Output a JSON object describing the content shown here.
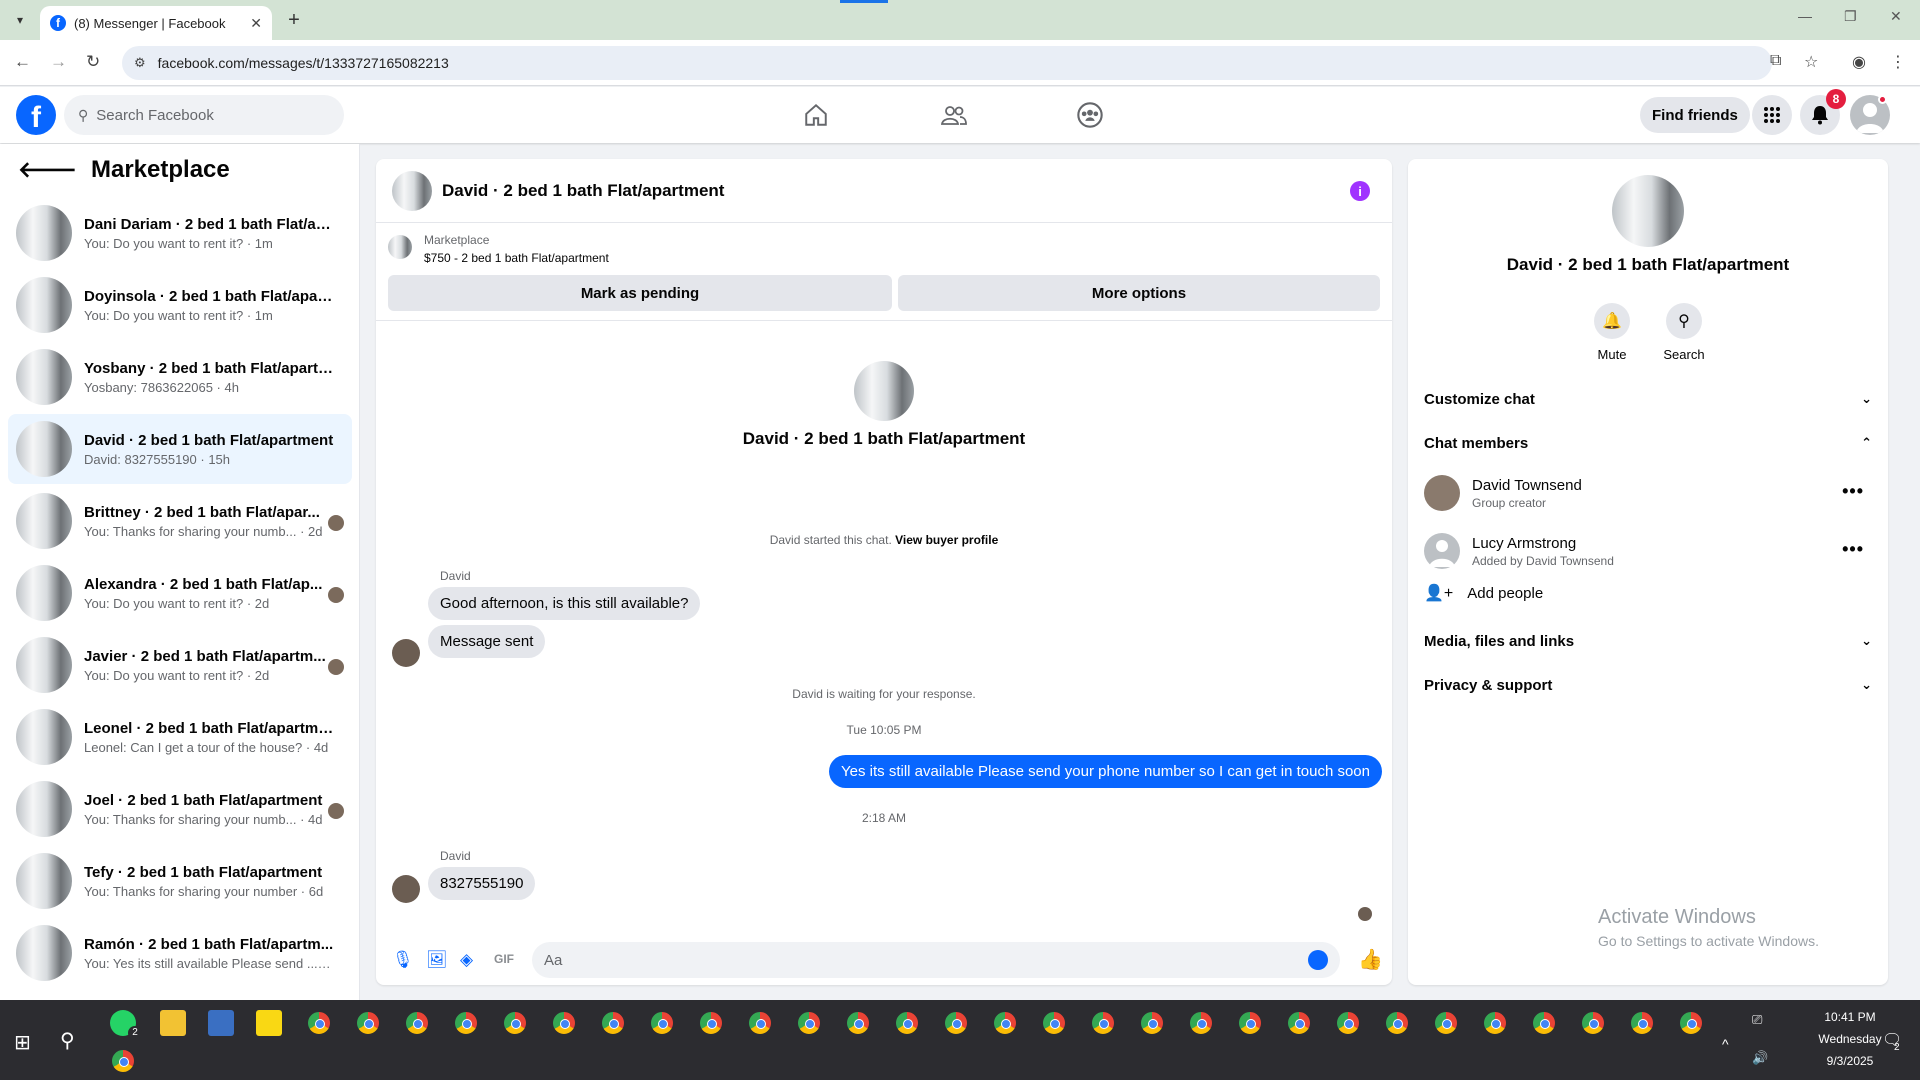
{
  "browser": {
    "tab_title": "(8) Messenger | Facebook",
    "url": "facebook.com/messages/t/1333727165082213"
  },
  "header": {
    "search_placeholder": "Search Facebook",
    "find_friends": "Find friends",
    "notification_count": "8",
    "brand_color": "#0866ff"
  },
  "sidebar": {
    "title": "Marketplace",
    "conversations": [
      {
        "name": "Dani Dariam · 2 bed 1 bath Flat/ap...",
        "preview": "You: Do you want to rent it? · 1m",
        "seen": false
      },
      {
        "name": "Doyinsola · 2 bed 1 bath Flat/apart...",
        "preview": "You: Do you want to rent it? · 1m",
        "seen": false
      },
      {
        "name": "Yosbany · 2 bed 1 bath Flat/apartm...",
        "preview": "Yosbany: 7863622065 · 4h",
        "seen": false
      },
      {
        "name": "David · 2 bed 1 bath Flat/apartment",
        "preview": "David: 8327555190 · 15h",
        "seen": false
      },
      {
        "name": "Brittney · 2 bed 1 bath Flat/apar...",
        "preview": "You: Thanks for sharing your numb... · 2d",
        "seen": true
      },
      {
        "name": "Alexandra · 2 bed 1 bath Flat/ap...",
        "preview": "You: Do you want to rent it? · 2d",
        "seen": true
      },
      {
        "name": "Javier · 2 bed 1 bath Flat/apartm...",
        "preview": "You: Do you want to rent it? · 2d",
        "seen": true
      },
      {
        "name": "Leonel · 2 bed 1 bath Flat/apartment",
        "preview": "Leonel: Can I get a tour of the house? · 4d",
        "seen": false
      },
      {
        "name": "Joel · 2 bed 1 bath Flat/apartment",
        "preview": "You: Thanks for sharing your numb... · 4d",
        "seen": true
      },
      {
        "name": "Tefy · 2 bed 1 bath Flat/apartment",
        "preview": "You: Thanks for sharing your number · 6d",
        "seen": false
      },
      {
        "name": "Ramón · 2 bed 1 bath Flat/apartm...",
        "preview": "You: Yes its still available Please send ... · 1w",
        "seen": false
      }
    ]
  },
  "chat": {
    "title": "David · 2 bed 1 bath Flat/apartment",
    "marketplace_label": "Marketplace",
    "listing": "$750 - 2 bed 1 bath Flat/apartment",
    "mark_pending": "Mark as pending",
    "more_options": "More options",
    "started_text": "David started this chat.",
    "view_buyer": "View buyer profile",
    "sender_name": "David",
    "msg1": "Good afternoon, is this still available?",
    "msg2": "Message sent",
    "waiting": "David is waiting for your response.",
    "time1": "Tue 10:05 PM",
    "out_msg": "Yes its still available Please send your phone number so I can get in touch soon",
    "time2": "2:18 AM",
    "msg3": "8327555190",
    "composer_placeholder": "Aa"
  },
  "details": {
    "title": "David · 2 bed 1 bath Flat/apartment",
    "mute": "Mute",
    "search": "Search",
    "customize": "Customize chat",
    "members": "Chat members",
    "member1_name": "David Townsend",
    "member1_sub": "Group creator",
    "member2_name": "Lucy Armstrong",
    "member2_sub": "Added by David Townsend",
    "add_people": "Add people",
    "media": "Media, files and links",
    "privacy": "Privacy & support"
  },
  "watermark": {
    "title": "Activate Windows",
    "sub": "Go to Settings to activate Windows."
  },
  "taskbar": {
    "whatsapp_badge": "2",
    "time": "10:41 PM",
    "day": "Wednesday",
    "date": "9/3/2025",
    "notif_count": "2"
  }
}
